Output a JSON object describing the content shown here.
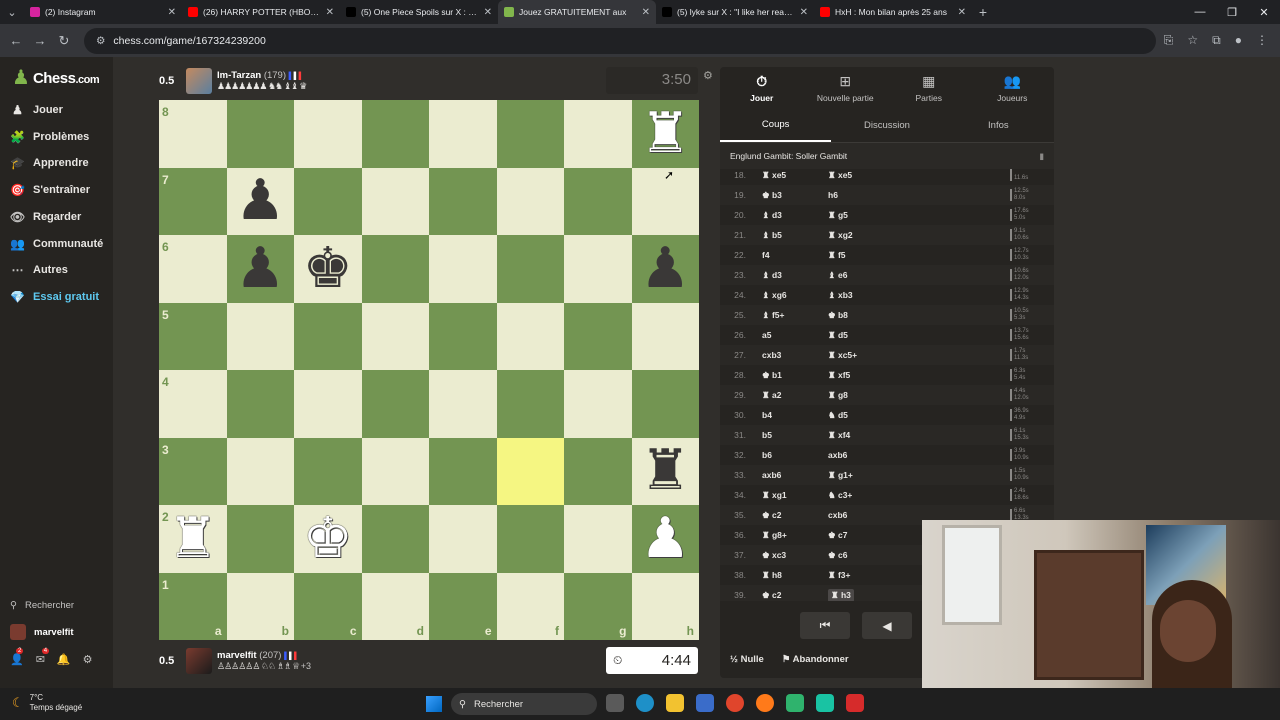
{
  "browser": {
    "tabs": [
      {
        "label": "(2) Instagram",
        "color": "#d6249f",
        "active": false
      },
      {
        "label": "(26) HARRY POTTER (HBO) - LE",
        "color": "#ff0000",
        "active": false
      },
      {
        "label": "(5) One Piece Spoils sur X : \"#O",
        "color": "#000000",
        "active": false
      },
      {
        "label": "Jouez GRATUITEMENT aux",
        "color": "#81b64c",
        "active": true
      },
      {
        "label": "(5) lyke sur X : \"I like her reactio",
        "color": "#000000",
        "active": false
      },
      {
        "label": "HxH : Mon bilan après 25 ans",
        "color": "#ff0000",
        "active": false
      }
    ],
    "new_tab": "+",
    "url": "chess.com/game/167324239200"
  },
  "sidebar": {
    "logo_text": "Chess",
    "logo_suffix": ".com",
    "items": [
      {
        "label": "Jouer",
        "icon": "play-pawn-icon"
      },
      {
        "label": "Problèmes",
        "icon": "puzzle-icon"
      },
      {
        "label": "Apprendre",
        "icon": "learn-icon"
      },
      {
        "label": "S'entraîner",
        "icon": "train-icon"
      },
      {
        "label": "Regarder",
        "icon": "watch-icon"
      },
      {
        "label": "Communauté",
        "icon": "community-icon"
      },
      {
        "label": "Autres",
        "icon": "more-icon"
      },
      {
        "label": "Essai gratuit",
        "icon": "diamond-icon"
      }
    ],
    "search_label": "Rechercher",
    "username": "marvelfit",
    "badges": {
      "notifications": "2",
      "messages": "4"
    }
  },
  "game": {
    "top_player": {
      "score": "0.5",
      "name": "Im-Tarzan",
      "rating": "(179)",
      "captured": "♟♟♟♟♟♟♟ ♞♞ ♝♝ ♛",
      "clock": "3:50"
    },
    "bottom_player": {
      "score": "0.5",
      "name": "marvelfit",
      "rating": "(207)",
      "captured": "♙♙♙♙♙♙ ♘♘ ♗♗ ♕",
      "plus": "+3",
      "clock": "4:44"
    },
    "ranks": [
      "8",
      "7",
      "6",
      "5",
      "4",
      "3",
      "2",
      "1"
    ],
    "files": [
      "a",
      "b",
      "c",
      "d",
      "e",
      "f",
      "g",
      "h"
    ],
    "highlight_square": "f3",
    "pieces": [
      {
        "square": "h8",
        "glyph": "♜",
        "color": "w"
      },
      {
        "square": "b7",
        "glyph": "♟",
        "color": "b"
      },
      {
        "square": "b6",
        "glyph": "♟",
        "color": "b"
      },
      {
        "square": "c6",
        "glyph": "♚",
        "color": "b"
      },
      {
        "square": "h6",
        "glyph": "♟",
        "color": "b"
      },
      {
        "square": "h3",
        "glyph": "♜",
        "color": "b"
      },
      {
        "square": "a2",
        "glyph": "♜",
        "color": "w"
      },
      {
        "square": "c2",
        "glyph": "♚",
        "color": "w"
      },
      {
        "square": "h2",
        "glyph": "♟",
        "color": "w"
      }
    ]
  },
  "panel": {
    "top_tabs": [
      {
        "label": "Jouer",
        "icon": "stopwatch-icon",
        "glyph": "⏱",
        "active": true
      },
      {
        "label": "Nouvelle partie",
        "icon": "plus-box-icon",
        "glyph": "⊞",
        "active": false
      },
      {
        "label": "Parties",
        "icon": "board-icon",
        "glyph": "▦",
        "active": false
      },
      {
        "label": "Joueurs",
        "icon": "players-icon",
        "glyph": "👥",
        "active": false
      }
    ],
    "sub_tabs": [
      {
        "label": "Coups",
        "active": true
      },
      {
        "label": "Discussion",
        "active": false
      },
      {
        "label": "Infos",
        "active": false
      }
    ],
    "opening": "Englund Gambit: Soller Gambit",
    "moves": [
      {
        "n": "18.",
        "w": "♜ xe5",
        "b": "♜ xe5",
        "t1": "",
        "t2": "11.6s"
      },
      {
        "n": "19.",
        "w": "♚ b3",
        "b": "h6",
        "t1": "12.5s",
        "t2": "8.0s"
      },
      {
        "n": "20.",
        "w": "♝ d3",
        "b": "♜ g5",
        "t1": "17.6s",
        "t2": "5.0s"
      },
      {
        "n": "21.",
        "w": "♝ b5",
        "b": "♜ xg2",
        "t1": "9.1s",
        "t2": "10.6s"
      },
      {
        "n": "22.",
        "w": "f4",
        "b": "♜ f5",
        "t1": "12.7s",
        "t2": "10.3s"
      },
      {
        "n": "23.",
        "w": "♝ d3",
        "b": "♝ e6",
        "t1": "10.6s",
        "t2": "12.0s"
      },
      {
        "n": "24.",
        "w": "♝ xg6",
        "b": "♝ xb3",
        "t1": "12.9s",
        "t2": "14.3s"
      },
      {
        "n": "25.",
        "w": "♝ f5+",
        "b": "♚ b8",
        "t1": "10.5s",
        "t2": "5.3s"
      },
      {
        "n": "26.",
        "w": "a5",
        "b": "♜ d5",
        "t1": "13.7s",
        "t2": "15.6s"
      },
      {
        "n": "27.",
        "w": "cxb3",
        "b": "♜ xc5+",
        "t1": "1.7s",
        "t2": "11.3s"
      },
      {
        "n": "28.",
        "w": "♚ b1",
        "b": "♜ xf5",
        "t1": "6.3s",
        "t2": "5.4s"
      },
      {
        "n": "29.",
        "w": "♜ a2",
        "b": "♜ g8",
        "t1": "4.4s",
        "t2": "12.0s"
      },
      {
        "n": "30.",
        "w": "b4",
        "b": "♞ d5",
        "t1": "36.9s",
        "t2": "4.9s"
      },
      {
        "n": "31.",
        "w": "b5",
        "b": "♜ xf4",
        "t1": "6.1s",
        "t2": "15.3s"
      },
      {
        "n": "32.",
        "w": "b6",
        "b": "axb6",
        "t1": "3.9s",
        "t2": "10.9s"
      },
      {
        "n": "33.",
        "w": "axb6",
        "b": "♜ g1+",
        "t1": "1.5s",
        "t2": "10.9s"
      },
      {
        "n": "34.",
        "w": "♜ xg1",
        "b": "♞ c3+",
        "t1": "2.4s",
        "t2": "18.6s"
      },
      {
        "n": "35.",
        "w": "♚ c2",
        "b": "cxb6",
        "t1": "6.6s",
        "t2": "13.3s"
      },
      {
        "n": "36.",
        "w": "♜ g8+",
        "b": "♚ c7",
        "t1": "",
        "t2": ""
      },
      {
        "n": "37.",
        "w": "♚ xc3",
        "b": "♚ c6",
        "t1": "",
        "t2": ""
      },
      {
        "n": "38.",
        "w": "♜ h8",
        "b": "♜ f3+",
        "t1": "",
        "t2": ""
      },
      {
        "n": "39.",
        "w": "♚ c2",
        "b": "♜ h3",
        "t1": "",
        "t2": ""
      }
    ],
    "nav": {
      "first": "⏮",
      "prev": "◀",
      "next": "▶"
    },
    "draw_label": "Nulle",
    "draw_prefix": "½",
    "resign_label": "Abandonner"
  },
  "taskbar": {
    "temp": "7°C",
    "weather": "Temps dégagé",
    "search": "Rechercher"
  }
}
